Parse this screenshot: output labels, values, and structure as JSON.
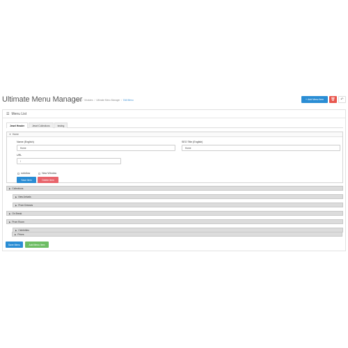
{
  "header": {
    "title": "Ultimate Menu Manager",
    "breadcrumb": [
      "Home",
      "Modules",
      "Ultimate Menu Manager",
      "Edit Menu"
    ],
    "add_item_label": "Add Menu Item",
    "add_icon": "plus-icon",
    "delete_icon": "trash-icon",
    "back_icon": "reply-icon"
  },
  "panel": {
    "heading": "Menu List",
    "heading_icon": "list-icon"
  },
  "tabs": [
    "Jewel Header",
    "Jewel Collections",
    "testing"
  ],
  "home_item": {
    "label": "Home",
    "name_label": "Name (English)",
    "name_value": "Home",
    "seo_label": "SEO Title (English)",
    "seo_value": "Home",
    "url_label": "URL",
    "url_value": "/",
    "nofollow_label": "nofollow",
    "new_window_label": "New Window",
    "save_item_label": "Save Item",
    "delete_item_label": "Delete Item"
  },
  "tree": [
    {
      "label": "Collections"
    },
    {
      "label": "New Arrivals"
    },
    {
      "label": "Prom Dresses"
    },
    {
      "label": "On Break"
    },
    {
      "label": "Prom Room"
    },
    {
      "label": "Celebrities"
    },
    {
      "label": "Prices"
    }
  ],
  "footer": {
    "save_menu_label": "Save Menu",
    "add_menu_item_label": "Add Menu Item"
  },
  "colors": {
    "primary": "#2a8dd4",
    "danger": "#e8564d",
    "success": "#6dbd63"
  }
}
